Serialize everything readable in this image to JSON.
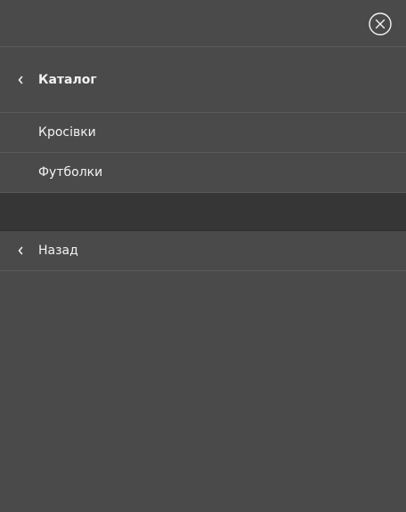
{
  "menu": {
    "close_icon": "close-circle-icon",
    "catalog_header": {
      "label": "Каталог",
      "icon": "chevron-left-icon"
    },
    "items": [
      {
        "label": "Кросівки"
      },
      {
        "label": "Футболки"
      }
    ],
    "back": {
      "label": "Назад",
      "icon": "chevron-left-icon"
    }
  },
  "colors": {
    "background": "#4a4a4a",
    "selected_row": "#363636",
    "divider": "#5b5b5b",
    "text": "#f2f2f2"
  }
}
